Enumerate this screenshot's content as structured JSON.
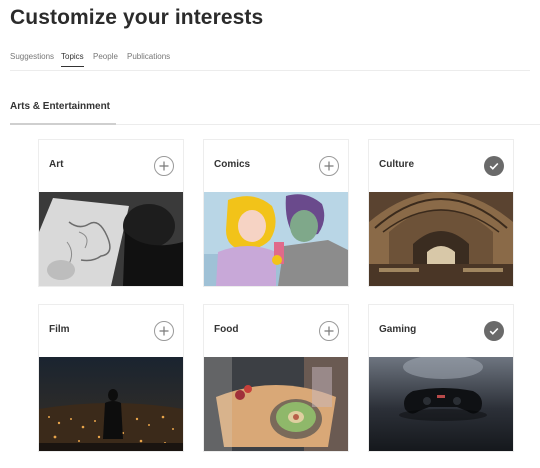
{
  "page": {
    "title": "Customize your interests"
  },
  "nav": {
    "tabs": [
      {
        "label": "Suggestions",
        "active": false
      },
      {
        "label": "Topics",
        "active": true
      },
      {
        "label": "People",
        "active": false
      },
      {
        "label": "Publications",
        "active": false
      }
    ]
  },
  "section": {
    "title": "Arts & Entertainment"
  },
  "topics": [
    {
      "label": "Art",
      "followed": false,
      "toggle_icon": "plus-icon",
      "image": "person drawing a sketch (black and white)"
    },
    {
      "label": "Comics",
      "followed": false,
      "toggle_icon": "plus-icon",
      "image": "pop-art comic panel of a couple"
    },
    {
      "label": "Culture",
      "followed": true,
      "toggle_icon": "check-icon",
      "image": "library hall with arched ceiling"
    },
    {
      "label": "Film",
      "followed": false,
      "toggle_icon": "plus-icon",
      "image": "silhouette over a city at night"
    },
    {
      "label": "Food",
      "followed": false,
      "toggle_icon": "plus-icon",
      "image": "plated dish with kiwi on a tray"
    },
    {
      "label": "Gaming",
      "followed": true,
      "toggle_icon": "check-icon",
      "image": "game controller on a dark surface"
    }
  ],
  "colors": {
    "toggle_on": "#6a6a6a",
    "toggle_off_border": "#9a9a9a"
  }
}
